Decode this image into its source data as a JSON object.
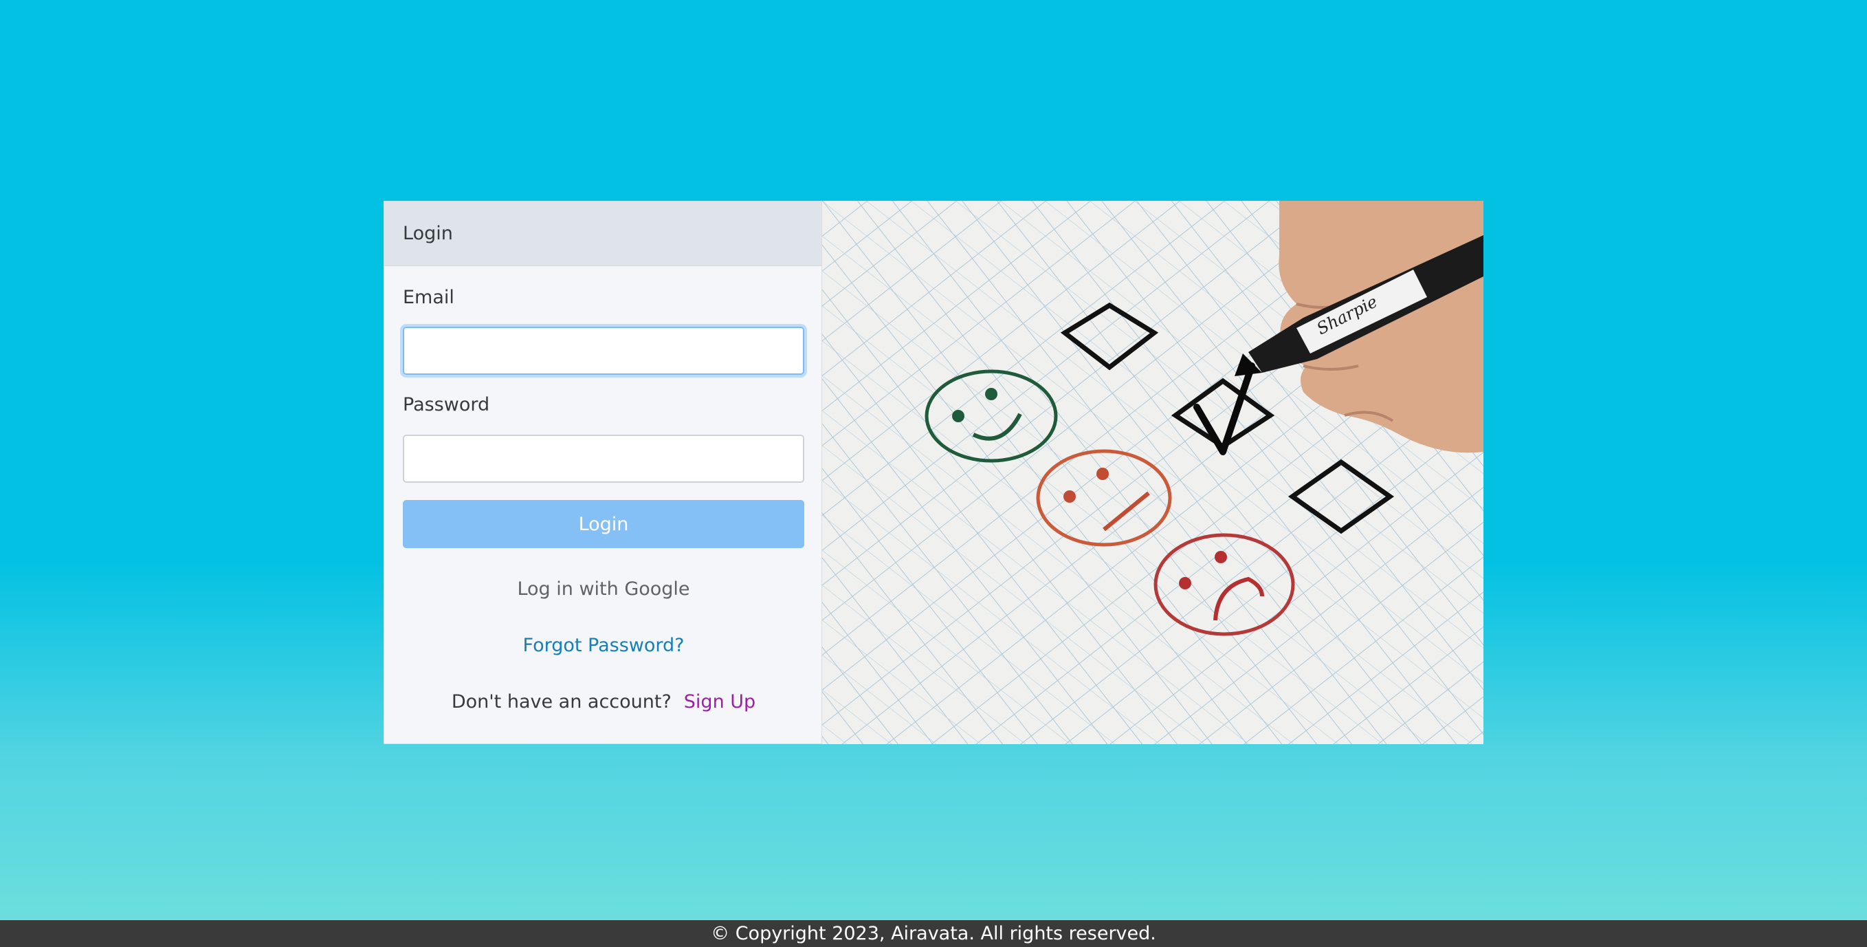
{
  "login": {
    "header": "Login",
    "email_label": "Email",
    "email_value": "",
    "password_label": "Password",
    "password_value": "",
    "login_button": "Login",
    "google_link": "Log in with Google",
    "forgot_link": "Forgot Password?",
    "no_account_text": "Don't have an account?",
    "signup_link": "Sign Up"
  },
  "illustration": {
    "pen_brand": "Sharpie"
  },
  "footer": {
    "copyright": "© Copyright 2023, Airavata. All rights reserved."
  },
  "colors": {
    "background_top": "#02c1e3",
    "background_bottom": "#6fe0dd",
    "login_button": "#84c0f6",
    "forgot_link": "#1580b8",
    "signup_link": "#9c1fa6",
    "footer": "#3a3a3a"
  }
}
